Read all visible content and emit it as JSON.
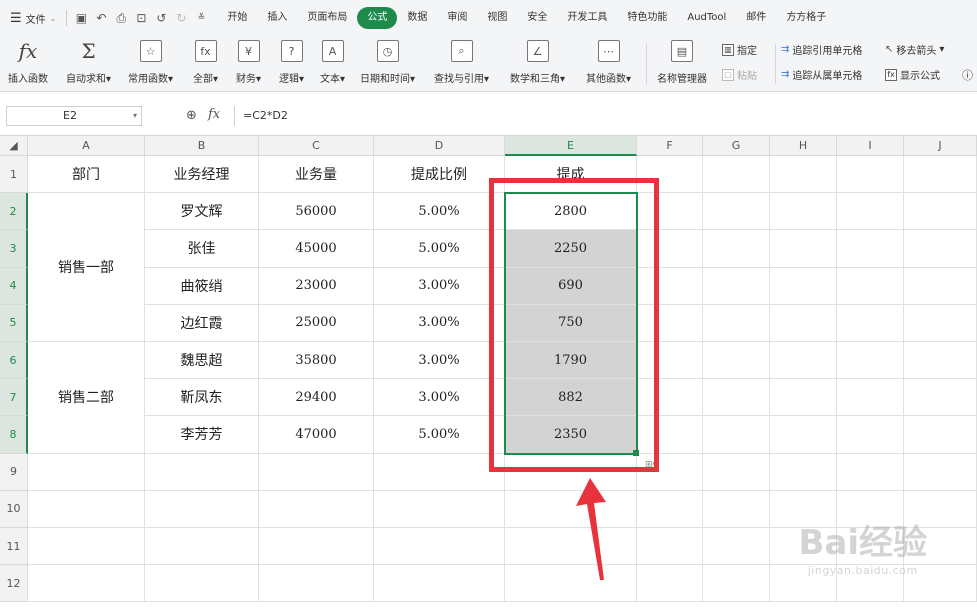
{
  "menubar": {
    "file_label": "文件",
    "quick_access": [
      "save-icon",
      "undo-history-icon",
      "print-icon",
      "print-preview-icon",
      "undo-icon",
      "redo-icon",
      "customize-icon"
    ],
    "tabs": [
      "开始",
      "插入",
      "页面布局",
      "公式",
      "数据",
      "审阅",
      "视图",
      "安全",
      "开发工具",
      "特色功能",
      "AudTool",
      "邮件",
      "方方格子"
    ],
    "active_tab": "公式"
  },
  "ribbon": {
    "insert_function": "插入函数",
    "autosum": "自动求和",
    "common_functions": "常用函数",
    "all": "全部",
    "financial": "财务",
    "logical": "逻辑",
    "text": "文本",
    "datetime": "日期和时间",
    "lookup": "查找与引用",
    "math": "数学和三角",
    "other": "其他函数",
    "name_manager": "名称管理器",
    "assign": "指定",
    "paste": "粘贴",
    "trace_precedents": "追踪引用单元格",
    "trace_dependents": "追踪从属单元格",
    "remove_arrows": "移去箭头",
    "show_formulas": "显示公式"
  },
  "formula_bar": {
    "name_box": "E2",
    "formula": "=C2*D2"
  },
  "sheet": {
    "columns": [
      "A",
      "B",
      "C",
      "D",
      "E",
      "F",
      "G",
      "H",
      "I",
      "J"
    ],
    "rows": [
      "1",
      "2",
      "3",
      "4",
      "5",
      "6",
      "7",
      "8",
      "9",
      "10",
      "11",
      "12"
    ],
    "selected_column": "E",
    "headers": [
      "部门",
      "业务经理",
      "业务量",
      "提成比例",
      "提成"
    ],
    "departments": [
      "销售一部",
      "销售二部"
    ],
    "records": [
      {
        "manager": "罗文辉",
        "volume": "56000",
        "rate": "5.00%",
        "commission": "2800"
      },
      {
        "manager": "张佳",
        "volume": "45000",
        "rate": "5.00%",
        "commission": "2250"
      },
      {
        "manager": "曲筱绡",
        "volume": "23000",
        "rate": "3.00%",
        "commission": "690"
      },
      {
        "manager": "边红霞",
        "volume": "25000",
        "rate": "3.00%",
        "commission": "750"
      },
      {
        "manager": "魏思超",
        "volume": "35800",
        "rate": "3.00%",
        "commission": "1790"
      },
      {
        "manager": "靳凤东",
        "volume": "29400",
        "rate": "3.00%",
        "commission": "882"
      },
      {
        "manager": "李芳芳",
        "volume": "47000",
        "rate": "5.00%",
        "commission": "2350"
      }
    ]
  },
  "annotation": {
    "highlight_color": "#e8333c"
  },
  "watermark": {
    "brand": "Bai经验",
    "url": "jingyan.baidu.com"
  },
  "colors": {
    "accent": "#1e8a4c",
    "selection_fill": "#d3d3d3"
  }
}
